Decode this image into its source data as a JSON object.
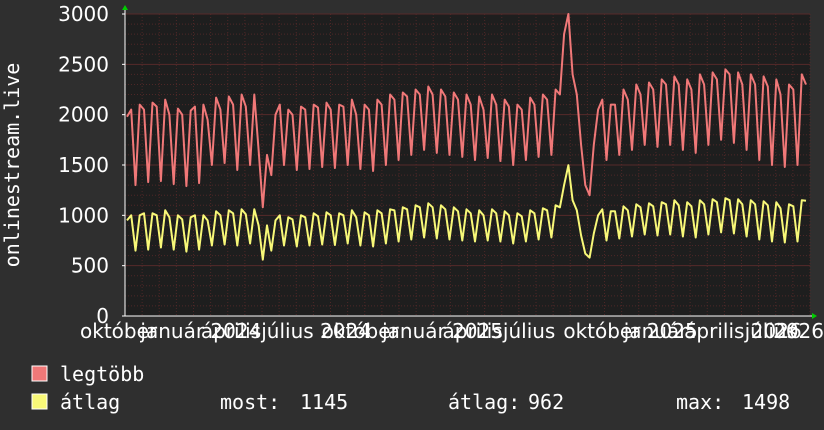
{
  "chart_data": {
    "type": "line",
    "ylabel": "onlinestream.live",
    "ylim": [
      0,
      3000
    ],
    "yticks": [
      0,
      500,
      1000,
      1500,
      2000,
      2500,
      3000
    ],
    "grid": true,
    "xtick_labels": [
      "október",
      "január 2024",
      "április",
      "július 2024",
      "október",
      "január 2025",
      "április",
      "július",
      "október 2025",
      "január",
      "április 2026",
      "július",
      "2026"
    ],
    "series": [
      {
        "name": "legtöbb",
        "color": "#f07878",
        "values": [
          1980,
          2050,
          1300,
          2100,
          2050,
          1330,
          2120,
          2080,
          1340,
          2150,
          2000,
          1310,
          2060,
          2000,
          1290,
          2040,
          2080,
          1320,
          2100,
          1950,
          1500,
          2170,
          2050,
          1520,
          2180,
          2100,
          1450,
          2200,
          2080,
          1500,
          2200,
          1650,
          1080,
          1600,
          1400,
          2000,
          2100,
          1500,
          2050,
          2000,
          1450,
          2080,
          2050,
          1460,
          2100,
          2070,
          1480,
          2120,
          2050,
          1470,
          2100,
          2080,
          1500,
          2150,
          2000,
          1460,
          2100,
          2050,
          1440,
          2150,
          2100,
          1500,
          2200,
          2150,
          1550,
          2220,
          2180,
          1600,
          2250,
          2200,
          1650,
          2280,
          2200,
          1620,
          2250,
          2180,
          1600,
          2220,
          2150,
          1580,
          2200,
          2100,
          1550,
          2180,
          2050,
          1570,
          2200,
          2100,
          1540,
          2150,
          2080,
          1500,
          2100,
          2050,
          1550,
          2170,
          2100,
          1580,
          2200,
          2150,
          1600,
          2250,
          2200,
          2800,
          3000,
          2400,
          2200,
          1700,
          1300,
          1200,
          1700,
          2050,
          2150,
          1550,
          2100,
          2100,
          1600,
          2250,
          2150,
          1650,
          2300,
          2200,
          1700,
          2320,
          2250,
          1680,
          2350,
          2300,
          1700,
          2380,
          2300,
          1650,
          2350,
          2250,
          1620,
          2400,
          2300,
          1700,
          2420,
          2350,
          1750,
          2450,
          2400,
          1720,
          2420,
          2300,
          1650,
          2400,
          2300,
          1550,
          2380,
          2280,
          1500,
          2350,
          2200,
          1480,
          2300,
          2250,
          1500,
          2400,
          2300
        ]
      },
      {
        "name": "átlag",
        "color": "#f8f878",
        "values": [
          950,
          1000,
          650,
          1000,
          1020,
          660,
          1020,
          1000,
          680,
          1050,
          980,
          660,
          1000,
          960,
          640,
          980,
          1000,
          660,
          1000,
          950,
          700,
          1040,
          1000,
          710,
          1050,
          1020,
          700,
          1060,
          1010,
          720,
          1060,
          900,
          560,
          900,
          650,
          950,
          1000,
          700,
          980,
          960,
          690,
          1000,
          980,
          700,
          1020,
          990,
          710,
          1030,
          1000,
          705,
          1020,
          1000,
          720,
          1050,
          980,
          700,
          1030,
          1000,
          690,
          1050,
          1020,
          720,
          1060,
          1050,
          740,
          1080,
          1060,
          760,
          1100,
          1080,
          780,
          1120,
          1080,
          770,
          1100,
          1060,
          760,
          1080,
          1040,
          750,
          1060,
          1020,
          740,
          1050,
          1000,
          750,
          1060,
          1020,
          740,
          1040,
          1000,
          720,
          1020,
          990,
          740,
          1050,
          1020,
          760,
          1070,
          1050,
          780,
          1100,
          1080,
          1300,
          1498,
          1150,
          1050,
          800,
          620,
          580,
          820,
          1000,
          1060,
          750,
          1040,
          1040,
          770,
          1090,
          1050,
          790,
          1110,
          1080,
          810,
          1120,
          1090,
          800,
          1130,
          1110,
          810,
          1150,
          1100,
          790,
          1130,
          1090,
          780,
          1150,
          1110,
          810,
          1160,
          1130,
          830,
          1170,
          1150,
          820,
          1160,
          1110,
          790,
          1150,
          1110,
          760,
          1140,
          1100,
          740,
          1130,
          1070,
          730,
          1110,
          1090,
          740,
          1150,
          1145
        ]
      }
    ]
  },
  "legend": {
    "items": [
      {
        "label": "legtöbb",
        "color": "#f07878"
      },
      {
        "label": "átlag",
        "color": "#f8f878"
      }
    ],
    "stats": {
      "now_label": "most:",
      "now_value": "1145",
      "avg_label": "átlag:",
      "avg_value": "962",
      "max_label": "max:",
      "max_value": "1498"
    }
  },
  "colors": {
    "background": "#2f2f2f",
    "plot_background": "#1e1e1e",
    "grid": "#5a2a2a",
    "axis": "#ffffff",
    "arrow": "#00cc00"
  }
}
